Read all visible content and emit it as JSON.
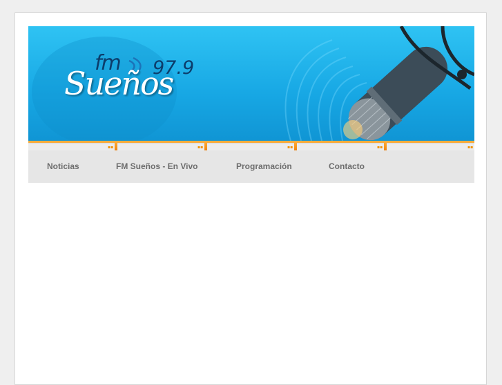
{
  "header": {
    "logo": {
      "prefix": "fm",
      "name": "Sueños",
      "frequency": "97.9"
    }
  },
  "nav": {
    "items": [
      {
        "label": "Noticias"
      },
      {
        "label": "FM Sueños - En Vivo"
      },
      {
        "label": "Programación"
      },
      {
        "label": "Contacto"
      }
    ]
  },
  "colors": {
    "page_background": "#efefef",
    "banner": "#1fb1ea",
    "accent_orange": "#f7941d",
    "navbar": "#e6e6e6",
    "nav_text": "#6d6d6d"
  }
}
